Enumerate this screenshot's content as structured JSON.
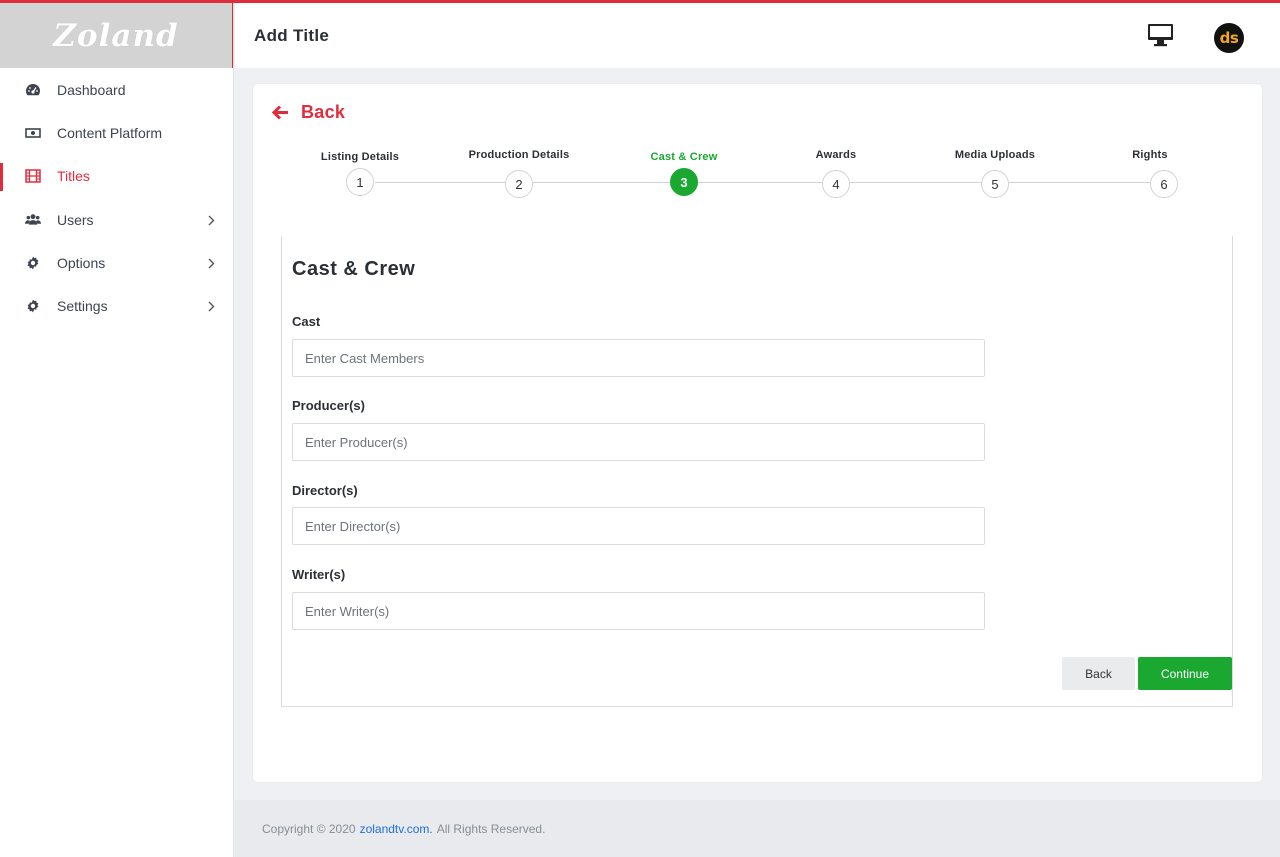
{
  "brand": {
    "logo_text": "Zoland",
    "accent": "#e12d3b",
    "success": "#1aa831"
  },
  "sidebar": {
    "items": [
      {
        "label": "Dashboard",
        "icon": "tachometer-icon",
        "has_submenu": false,
        "active": false
      },
      {
        "label": "Content Platform",
        "icon": "money-icon",
        "has_submenu": false,
        "active": false
      },
      {
        "label": "Titles",
        "icon": "film-icon",
        "has_submenu": false,
        "active": true
      },
      {
        "label": "Users",
        "icon": "users-icon",
        "has_submenu": true,
        "active": false
      },
      {
        "label": "Options",
        "icon": "gear-icon",
        "has_submenu": true,
        "active": false
      },
      {
        "label": "Settings",
        "icon": "gear-icon",
        "has_submenu": true,
        "active": false
      }
    ]
  },
  "header": {
    "title": "Add Title",
    "monitor_icon": "desktop-monitor-icon",
    "avatar_initials": "ds"
  },
  "main": {
    "back_label": "Back",
    "stepper": {
      "current_step": 3,
      "steps": [
        {
          "label": "Listing Details",
          "number": "1"
        },
        {
          "label": "Production Details",
          "number": "2"
        },
        {
          "label": "Cast & Crew",
          "number": "3"
        },
        {
          "label": "Awards",
          "number": "4"
        },
        {
          "label": "Media Uploads",
          "number": "5"
        },
        {
          "label": "Rights",
          "number": "6"
        }
      ]
    },
    "form": {
      "title": "Cast & Crew",
      "fields": [
        {
          "label": "Cast",
          "placeholder": "Enter Cast Members",
          "value": ""
        },
        {
          "label": "Producer(s)",
          "placeholder": "Enter Producer(s)",
          "value": ""
        },
        {
          "label": "Director(s)",
          "placeholder": "Enter Director(s)",
          "value": ""
        },
        {
          "label": "Writer(s)",
          "placeholder": "Enter Writer(s)",
          "value": ""
        }
      ],
      "back_button": "Back",
      "continue_button": "Continue"
    }
  },
  "footer": {
    "prefix": "Copyright © 2020",
    "link_text": "zolandtv.com.",
    "suffix": "All Rights Reserved."
  }
}
